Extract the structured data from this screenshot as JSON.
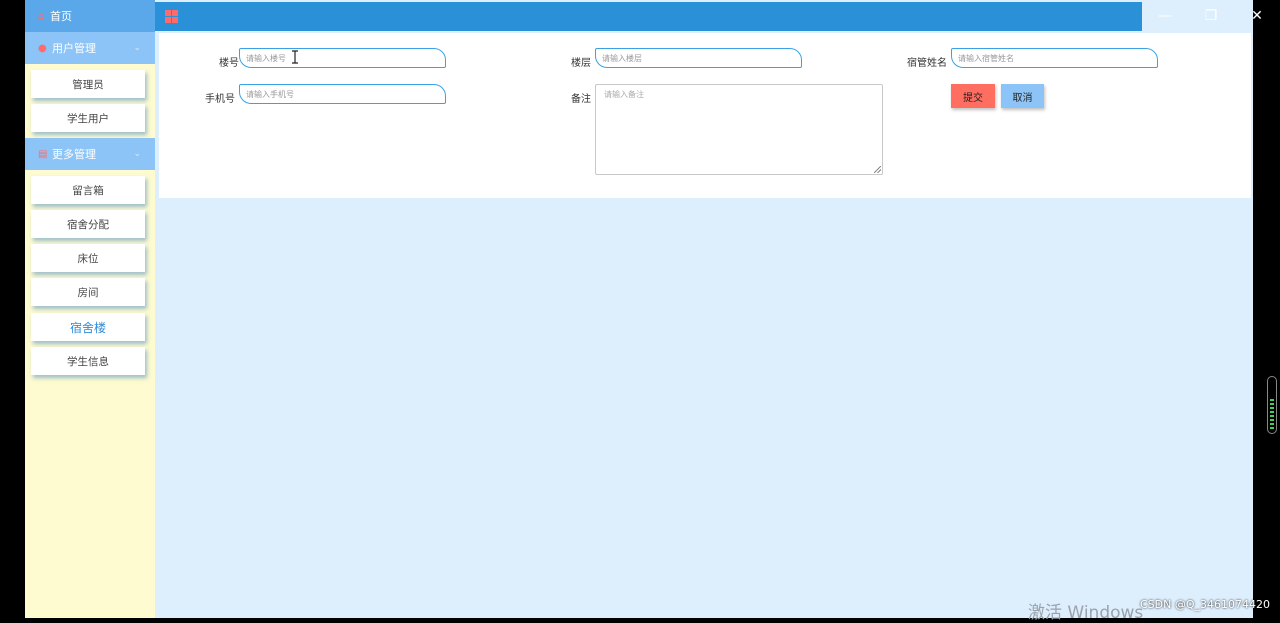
{
  "window_controls": {
    "minimize": "—",
    "maximize": "❐",
    "close": "✕"
  },
  "sidebar": {
    "home": {
      "icon": "home-icon",
      "label": "首页"
    },
    "groups": [
      {
        "icon": "user-icon",
        "label": "用户管理",
        "items": [
          "管理员",
          "学生用户"
        ]
      },
      {
        "icon": "calendar-icon",
        "label": "更多管理",
        "items": [
          "留言箱",
          "宿舍分配",
          "床位",
          "房间",
          "宿舍楼",
          "学生信息"
        ]
      }
    ],
    "active_item": "宿舍楼"
  },
  "topbar": {
    "icon": "grid-icon"
  },
  "form": {
    "building_no": {
      "label": "楼号",
      "placeholder": "请输入楼号"
    },
    "floor": {
      "label": "楼层",
      "placeholder": "请输入楼层"
    },
    "manager_name": {
      "label": "宿管姓名",
      "placeholder": "请输入宿管姓名"
    },
    "phone": {
      "label": "手机号",
      "placeholder": "请输入手机号"
    },
    "remark": {
      "label": "备注",
      "placeholder": "请输入备注"
    },
    "submit_label": "提交",
    "cancel_label": "取消"
  },
  "colors": {
    "accent": "#2a90d7",
    "sidebar_bg": "#fdfbcf",
    "submit": "#ff6e61",
    "cancel": "#8cc4f7"
  },
  "overlay": {
    "watermark": "激活 Windows",
    "credit": "CSDN @Q_3461074420"
  }
}
